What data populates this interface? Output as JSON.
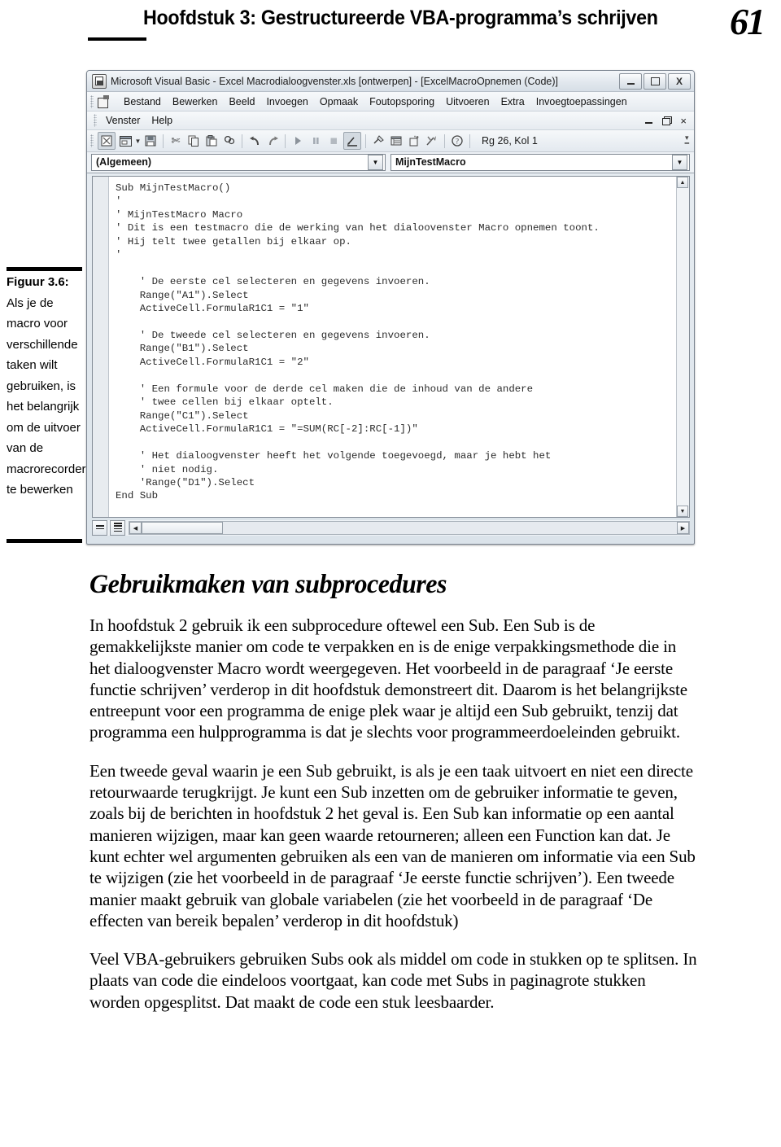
{
  "header": {
    "chapter_title": "Hoofdstuk 3: Gestructureerde VBA-programma’s schrijven",
    "page_number": "61"
  },
  "figure": {
    "label": "Figuur 3.6:",
    "caption": "Als je de macro voor verschillende taken wilt gebruiken, is het belangrijk om de uitvoer van de macrorecorder te bewerken"
  },
  "vba_window": {
    "title": "Microsoft Visual Basic - Excel Macrodialoogvenster.xls [ontwerpen] - [ExcelMacroOpnemen (Code)]",
    "window_controls": {
      "minimize": "–",
      "maximize": "□",
      "close": "X"
    },
    "mdi_controls": {
      "minimize": "_",
      "restore": "❐",
      "close": "×"
    },
    "menu_row1": [
      "Bestand",
      "Bewerken",
      "Beeld",
      "Invoegen",
      "Opmaak",
      "Foutopsporing",
      "Uitvoeren",
      "Extra",
      "Invoegtoepassingen"
    ],
    "menu_row2": [
      "Venster",
      "Help"
    ],
    "toolbar": {
      "icons": [
        "view-excel-icon",
        "userform-icon",
        "dropdown-caret",
        "save-icon",
        "cut-icon",
        "copy-icon",
        "paste-icon",
        "find-icon",
        "undo-icon",
        "redo-icon",
        "run-icon",
        "pause-icon",
        "stop-icon",
        "design-mode-icon",
        "project-explorer-icon",
        "properties-window-icon",
        "object-browser-icon",
        "toolbox-icon",
        "help-icon"
      ],
      "status": "Rg 26, Kol 1"
    },
    "dropdowns": {
      "object": "(Algemeen)",
      "procedure": "MijnTestMacro"
    },
    "code": "Sub MijnTestMacro()\n'\n' MijnTestMacro Macro\n' Dit is een testmacro die de werking van het dialoovenster Macro opnemen toont.\n' Hij telt twee getallen bij elkaar op.\n'\n\n    ' De eerste cel selecteren en gegevens invoeren.\n    Range(\"A1\").Select\n    ActiveCell.FormulaR1C1 = \"1\"\n\n    ' De tweede cel selecteren en gegevens invoeren.\n    Range(\"B1\").Select\n    ActiveCell.FormulaR1C1 = \"2\"\n\n    ' Een formule voor de derde cel maken die de inhoud van de andere\n    ' twee cellen bij elkaar optelt.\n    Range(\"C1\").Select\n    ActiveCell.FormulaR1C1 = \"=SUM(RC[-2]:RC[-1])\"\n\n    ' Het dialoogvenster heeft het volgende toegevoegd, maar je hebt het\n    ' niet nodig.\n    'Range(\"D1\").Select\nEnd Sub"
  },
  "content": {
    "section_heading": "Gebruikmaken van subprocedures",
    "paragraphs": [
      "In hoofdstuk 2 gebruik ik een subprocedure oftewel een Sub. Een Sub is de gemakkelijkste manier om code te verpakken en is de enige verpakkingsmethode die in het dialoogvenster Macro wordt weergegeven. Het voorbeeld in de paragraaf ‘Je eerste functie schrijven’ verderop in dit hoofdstuk demonstreert dit. Daarom is het belangrijkste entreepunt voor een programma de enige plek waar je altijd een Sub gebruikt, tenzij dat programma een hulpprogramma is dat je slechts voor programmeerdoeleinden gebruikt.",
      "Een tweede geval waarin je een Sub gebruikt, is als je een taak uitvoert en niet een directe retourwaarde terugkrijgt. Je kunt een Sub inzetten om de gebruiker informatie te geven, zoals bij de berichten in hoofdstuk 2 het geval is. Een Sub kan informatie op een aantal manieren wijzigen, maar kan geen waarde retourneren; alleen een Function kan dat. Je kunt echter wel argumenten gebruiken als een van de manieren om informatie via een Sub te wijzigen (zie het voorbeeld in de paragraaf ‘Je eerste functie schrijven’). Een tweede manier maakt gebruik van globale variabelen (zie het voorbeeld in de paragraaf ‘De effecten van bereik bepalen’ verderop in dit hoofdstuk)",
      "Veel VBA-gebruikers gebruiken Subs ook als middel om code in stukken op te splitsen. In plaats van code die eindeloos voortgaat, kan code met Subs in paginagrote stukken worden opgesplitst. Dat maakt de code een stuk leesbaarder."
    ]
  }
}
